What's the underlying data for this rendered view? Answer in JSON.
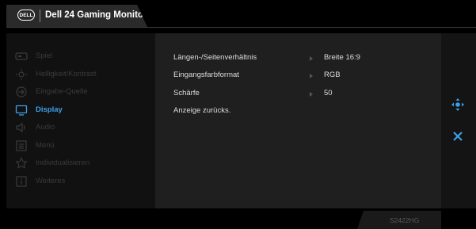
{
  "header": {
    "logo_text": "DELL",
    "title": "Dell 24 Gaming Monitor"
  },
  "sidebar": {
    "items": [
      {
        "label": "Spiel",
        "icon": "gamepad-icon",
        "active": false
      },
      {
        "label": "Helligkeit/Kontrast",
        "icon": "sun-icon",
        "active": false
      },
      {
        "label": "Eingabe-Quelle",
        "icon": "input-source-icon",
        "active": false
      },
      {
        "label": "Display",
        "icon": "monitor-icon",
        "active": true
      },
      {
        "label": "Audio",
        "icon": "speaker-icon",
        "active": false
      },
      {
        "label": "Menü",
        "icon": "menu-icon",
        "active": false
      },
      {
        "label": "Individualisieren",
        "icon": "star-icon",
        "active": false
      },
      {
        "label": "Weiteres",
        "icon": "info-icon",
        "active": false
      }
    ]
  },
  "options": [
    {
      "label": "Längen-/Seitenverhältnis",
      "value": "Breite 16:9"
    },
    {
      "label": "Eingangsfarbformat",
      "value": "RGB"
    },
    {
      "label": "Schärfe",
      "value": "50"
    },
    {
      "label": "Anzeige zurücks.",
      "value": ""
    }
  ],
  "controls": {
    "nav_icon": "four-way-navigate-icon",
    "close_icon": "close-icon"
  },
  "footer": {
    "model": "S2422HG"
  },
  "colors": {
    "accent": "#3d9fe8",
    "panel": "#1f1f1f",
    "sidebar": "#111111"
  }
}
